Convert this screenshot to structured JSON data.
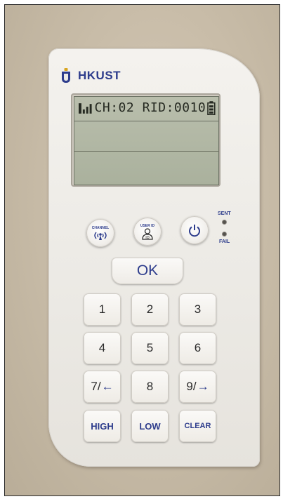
{
  "brand": {
    "name": "HKUST",
    "color": "#2d3c8c"
  },
  "display": {
    "status_line": "CH:02 RID:0010",
    "signal_icon": "signal-bars-icon",
    "battery_icon": "battery-icon"
  },
  "function_buttons": {
    "channel_label": "CHANNEL",
    "channel_icon": "antenna-signal-icon",
    "user_id_label": "USER ID",
    "user_id_icon": "user-id-icon",
    "power_icon": "power-icon"
  },
  "indicators": {
    "sent_label": "SENT",
    "fail_label": "FAIL"
  },
  "ok_label": "OK",
  "keypad": {
    "k1": "1",
    "k2": "2",
    "k3": "3",
    "k4": "4",
    "k5": "5",
    "k6": "6",
    "k7": "7/",
    "k8": "8",
    "k9": "9/",
    "k7_arrow": "←",
    "k9_arrow": "→",
    "high": "HIGH",
    "low": "LOW",
    "clear": "CLEAR"
  }
}
